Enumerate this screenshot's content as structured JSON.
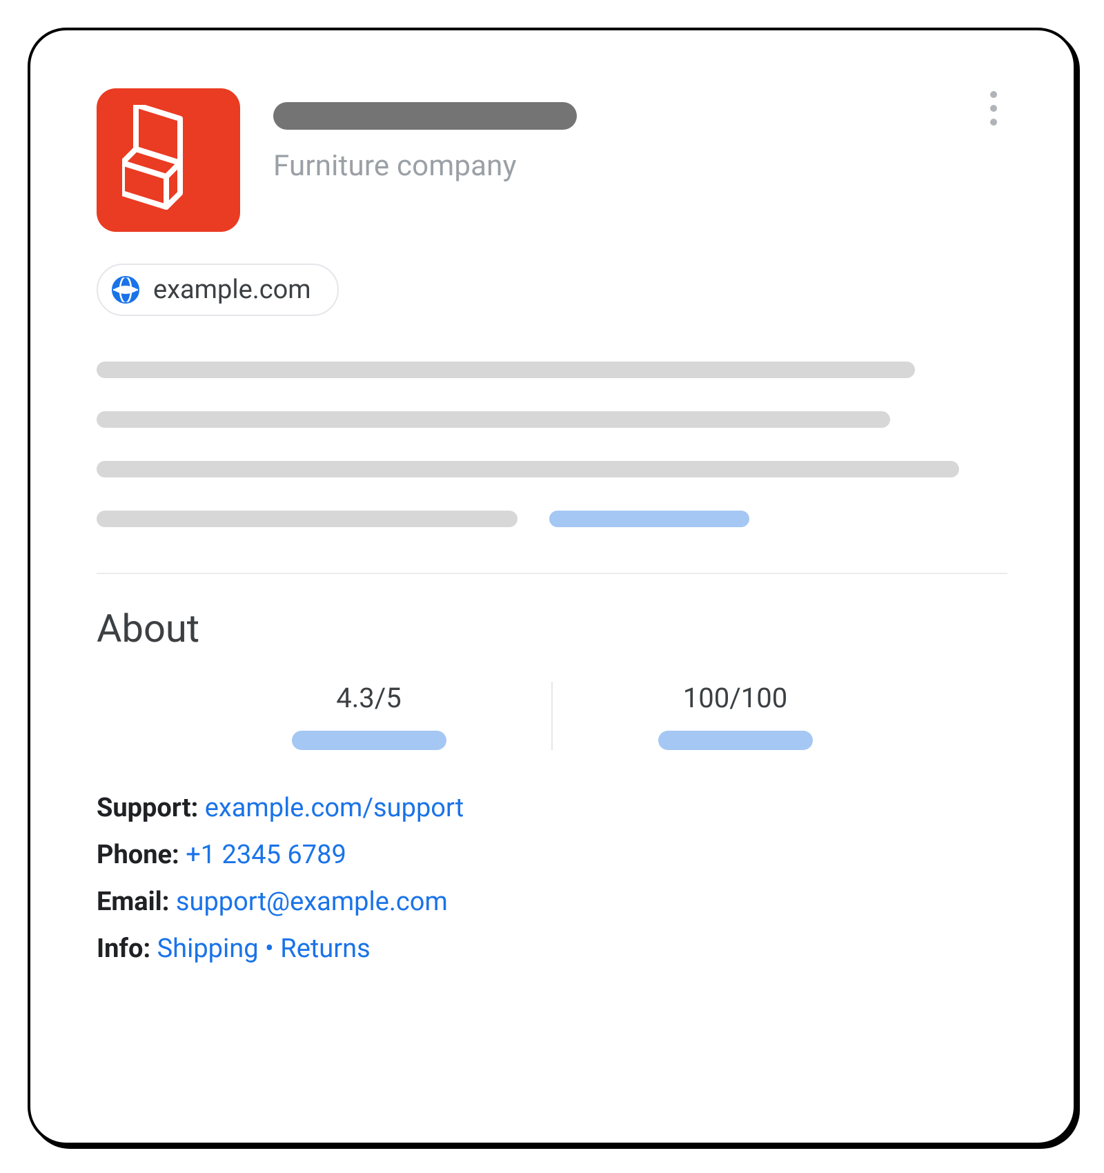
{
  "header": {
    "subtitle": "Furniture company",
    "logo_accent": "#ea3b23"
  },
  "url_chip": {
    "domain": "example.com"
  },
  "about": {
    "heading": "About",
    "stats": {
      "rating": "4.3/5",
      "score": "100/100"
    },
    "contact": {
      "support_label": "Support:",
      "support_link": "example.com/support",
      "phone_label": "Phone:",
      "phone_link": "+1 2345 6789",
      "email_label": "Email:",
      "email_link": "support@example.com",
      "info_label": "Info:",
      "info_link1": "Shipping",
      "info_separator": " • ",
      "info_link2": "Returns"
    }
  }
}
